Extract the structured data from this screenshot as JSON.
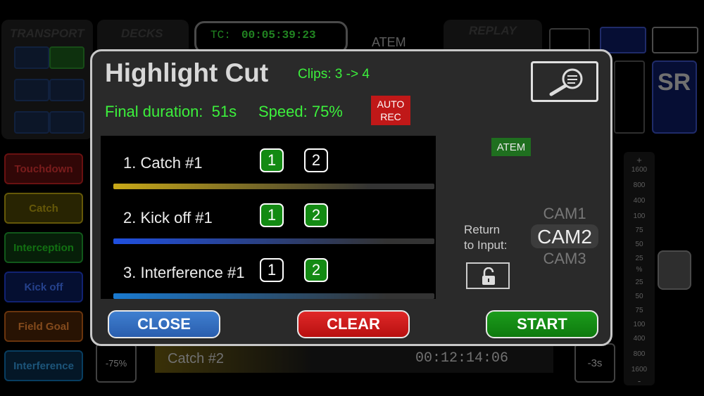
{
  "background": {
    "transport_label": "TRANSPORT",
    "decks_label": "DECKS",
    "tc_label": "TC:",
    "tc_value": "00:05:39:23",
    "atem_label": "ATEM",
    "replay_label": "REPLAY",
    "sr_label": "SR",
    "side_buttons": [
      {
        "label": "Touchdown",
        "color": "#c02020"
      },
      {
        "label": "Catch",
        "color": "#b8a010"
      },
      {
        "label": "Interception",
        "color": "#20a030"
      },
      {
        "label": "Kick off",
        "color": "#1f3fd0"
      },
      {
        "label": "Field Goal",
        "color": "#c06018"
      },
      {
        "label": "Interference",
        "color": "#1070b0"
      }
    ],
    "speed_left": "-75%",
    "speed_right": "-3s",
    "bottom_clip_name": "Catch #2",
    "bottom_timecode": "00:12:14:06",
    "scale_top_sign": "+",
    "scale_bottom_sign": "-",
    "scale_labels_top": [
      "1600",
      "800",
      "400",
      "100",
      "75",
      "50",
      "25"
    ],
    "scale_mid": "%",
    "scale_labels_bottom": [
      "25",
      "50",
      "75",
      "100",
      "400",
      "800",
      "1600"
    ]
  },
  "dialog": {
    "title": "Highlight Cut",
    "clips_text": "Clips: 3 -> 4",
    "final_duration_text": "Final duration:  51s",
    "speed_text": "Speed: 75%",
    "auto_rec_line1": "AUTO",
    "auto_rec_line2": "REC",
    "atem_badge": "ATEM",
    "return_to_input_line1": "Return",
    "return_to_input_line2": "to Input:",
    "cams": [
      "CAM1",
      "CAM2",
      "CAM3"
    ],
    "selected_cam": "CAM2",
    "clips": [
      {
        "label": "1. Catch #1",
        "ch1": "1",
        "ch1_on": true,
        "ch2": "2",
        "ch2_on": false,
        "bar_color": "#c8a818"
      },
      {
        "label": "2. Kick off #1",
        "ch1": "1",
        "ch1_on": true,
        "ch2": "2",
        "ch2_on": true,
        "bar_color": "#1f4fe0"
      },
      {
        "label": "3. Interference #1",
        "ch1": "1",
        "ch1_on": false,
        "ch2": "2",
        "ch2_on": true,
        "bar_color": "#1a7ad0"
      }
    ],
    "close_label": "CLOSE",
    "clear_label": "CLEAR",
    "start_label": "START",
    "colors": {
      "accent_green": "#3cf03c",
      "close": "#2f6fc0",
      "clear": "#d01818",
      "start": "#128a12"
    }
  }
}
